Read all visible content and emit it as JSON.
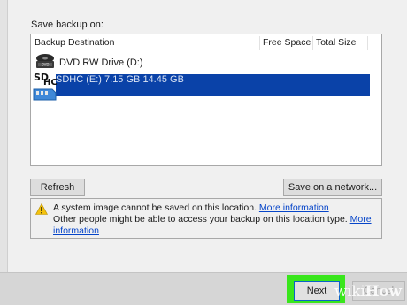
{
  "dialog": {
    "heading": "Save backup on:"
  },
  "table": {
    "columns": [
      "Backup Destination",
      "Free Space",
      "Total Size"
    ],
    "rows": [
      {
        "name": "DVD RW Drive (D:)",
        "free": "",
        "total": "",
        "icon": "dvd-drive-icon",
        "selected": false
      },
      {
        "name": "SDHC (E:)",
        "free": "7.15 GB",
        "total": "14.45 GB",
        "icon": "sd-card-icon",
        "selected": true
      }
    ]
  },
  "buttons": {
    "refresh": "Refresh",
    "save_network": "Save on a network...",
    "next": "Next",
    "cancel": "Cancel"
  },
  "info": {
    "line1_text": "A system image cannot be saved on this location.",
    "line1_link": "More information",
    "line2_text": "Other people might be able to access your backup on this location type.",
    "line2_link_part1": "More",
    "line2_link_part2": "information"
  },
  "icons": {
    "dvd_label": "DVD",
    "sd_label_1": "SD",
    "sd_label_2": "HC"
  },
  "watermark": {
    "part1": "wiki",
    "part2": "How"
  },
  "colors": {
    "selection": "#0a42a8",
    "link": "#0645c9",
    "highlight": "#39e61c",
    "background": "#f0f0f0"
  }
}
